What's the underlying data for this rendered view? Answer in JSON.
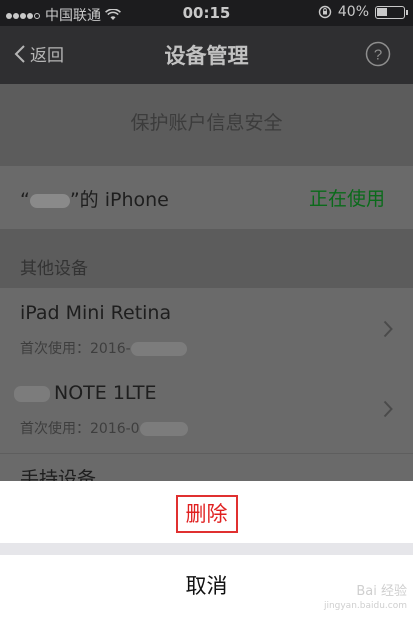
{
  "status_bar": {
    "carrier": "中国联通",
    "time": "00:15",
    "battery": "40%",
    "battery_level": 0.4
  },
  "nav": {
    "back_label": "返回",
    "title": "设备管理"
  },
  "banner": "保护账户信息安全",
  "current_device": {
    "name_open_quote": "“",
    "name_suffix": "”的 iPhone",
    "status": "正在使用"
  },
  "section_header": "其他设备",
  "devices": [
    {
      "title": "iPad Mini Retina",
      "first_used_label": "首次使用：2016-"
    },
    {
      "title": "NOTE 1LTE",
      "first_used_label": "首次使用：2016-0"
    }
  ],
  "partial_device": {
    "title": "手持设备"
  },
  "sheet": {
    "delete_label": "删除",
    "cancel_label": "取消"
  },
  "watermark": {
    "line1": "Bai 经验",
    "line2": "jingyan.baidu.com"
  },
  "colors": {
    "delete": "#e02020",
    "in_use": "#0a6a1a",
    "nav_bg": "#2f2f31"
  }
}
